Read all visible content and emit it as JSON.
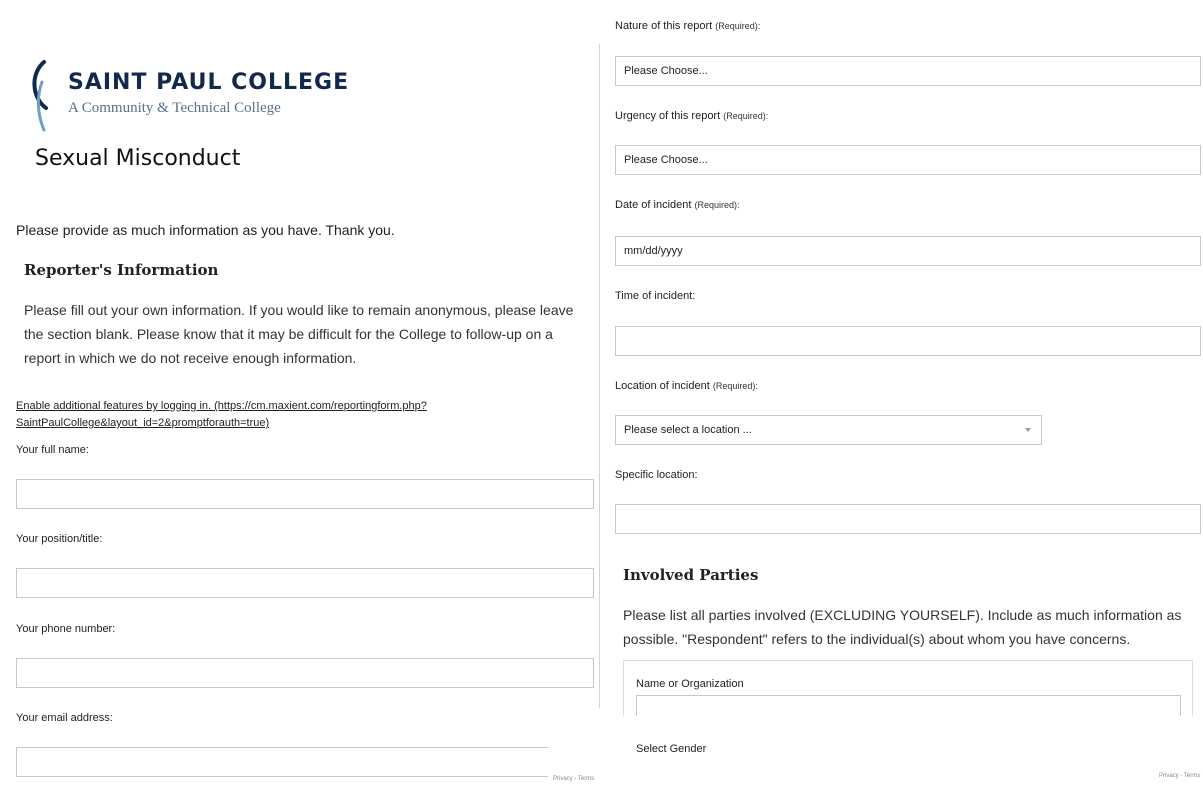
{
  "header": {
    "college_name": "SAINT PAUL COLLEGE",
    "college_subtitle": "A Community & Technical College",
    "page_title": "Sexual Misconduct"
  },
  "intro_text": "Please provide as much information as you have. Thank you.",
  "reporter": {
    "heading": "Reporter's Information",
    "description": "Please fill out your own information. If you would like to remain anonymous, please leave the section blank. Please know that it may be difficult for the College to follow-up on a report in which we do not receive enough information.",
    "login_link": "Enable additional features by logging in. (https://cm.maxient.com/reportingform.php?SaintPaulCollege&layout_id=2&promptforauth=true)",
    "fields": {
      "full_name_label": "Your full name:",
      "full_name_value": "",
      "position_label": "Your position/title:",
      "position_value": "",
      "phone_label": "Your phone number:",
      "phone_value": "",
      "email_label": "Your email address:",
      "email_value": ""
    }
  },
  "report": {
    "required_tag": "(Required):",
    "nature_label": "Nature of this report",
    "nature_value": "Please Choose...",
    "urgency_label": "Urgency of this report",
    "urgency_value": "Please Choose...",
    "date_label": "Date of incident",
    "date_placeholder": "mm/dd/yyyy",
    "time_label": "Time of incident:",
    "time_value": "",
    "location_label": "Location of incident",
    "location_value": "Please select a location ...",
    "specific_location_label": "Specific location:",
    "specific_location_value": ""
  },
  "involved": {
    "heading": "Involved Parties",
    "description": "Please list all parties involved (EXCLUDING YOURSELF). Include as much information as possible. \"Respondent\" refers to the individual(s) about whom you have concerns.",
    "name_label": "Name or Organization",
    "name_value": "",
    "gender_label": "Select Gender"
  },
  "recaptcha": {
    "left_text": "Privacy - Terms",
    "right_text": "Privacy - Terms"
  },
  "colors": {
    "brand_navy": "#13294b",
    "brand_light": "#5a6f8a",
    "logo_arc": "#6f9fc8"
  }
}
